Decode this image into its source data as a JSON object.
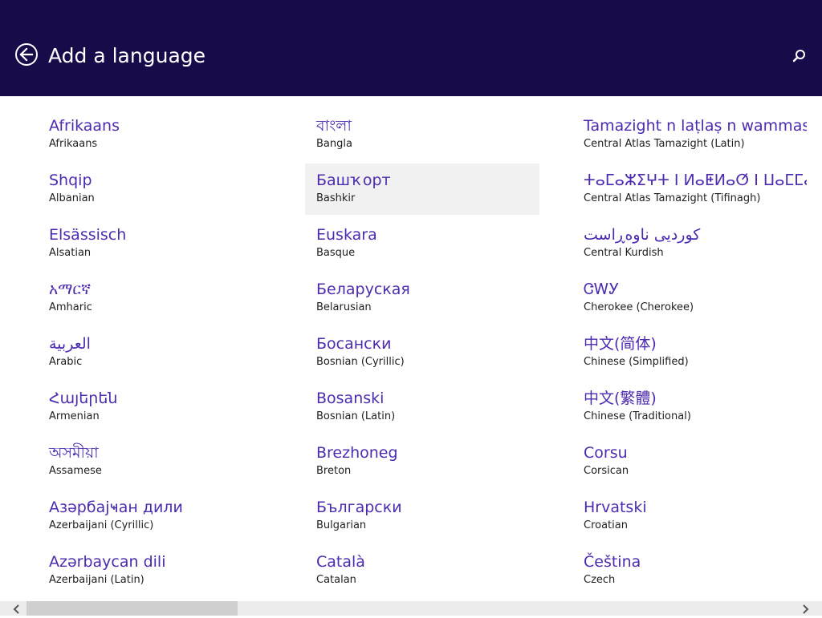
{
  "header": {
    "title": "Add a language",
    "back_icon": "back-arrow-circle-icon",
    "search_icon": "search-icon",
    "background": "#180b4a"
  },
  "columns": [
    [
      {
        "native": "Afrikaans",
        "english": "Afrikaans"
      },
      {
        "native": "Shqip",
        "english": "Albanian"
      },
      {
        "native": "Elsässisch",
        "english": "Alsatian"
      },
      {
        "native": "አማርኛ",
        "english": "Amharic"
      },
      {
        "native": "العربية",
        "english": "Arabic"
      },
      {
        "native": "Հայերեն",
        "english": "Armenian"
      },
      {
        "native": "অসমীয়া",
        "english": "Assamese"
      },
      {
        "native": "Азәрбајҹан дили",
        "english": "Azerbaijani (Cyrillic)"
      },
      {
        "native": "Azərbaycan dili",
        "english": "Azerbaijani (Latin)"
      }
    ],
    [
      {
        "native": "বাংলা",
        "english": "Bangla"
      },
      {
        "native": "Башҡорт",
        "english": "Bashkir",
        "hover": true
      },
      {
        "native": "Euskara",
        "english": "Basque"
      },
      {
        "native": "Беларуская",
        "english": "Belarusian"
      },
      {
        "native": "Босански",
        "english": "Bosnian (Cyrillic)"
      },
      {
        "native": "Bosanski",
        "english": "Bosnian (Latin)"
      },
      {
        "native": "Brezhoneg",
        "english": "Breton"
      },
      {
        "native": "Български",
        "english": "Bulgarian"
      },
      {
        "native": "Català",
        "english": "Catalan"
      }
    ],
    [
      {
        "native": "Tamazight n laṭlaṣ n wammas",
        "english": "Central Atlas Tamazight (Latin)"
      },
      {
        "native": "ⵜⴰⵎⴰⵣⵉⵖⵜ ⵏ ⵍⴰⵟⵍⴰⵚ ⵏ ⵡⴰⵎⵎⴰⵙ",
        "english": "Central Atlas Tamazight (Tifinagh)"
      },
      {
        "native": "کوردیی ناوەڕاست",
        "english": "Central Kurdish"
      },
      {
        "native": "ᏣᎳᎩ",
        "english": "Cherokee (Cherokee)"
      },
      {
        "native": "中文(简体)",
        "english": "Chinese (Simplified)"
      },
      {
        "native": "中文(繁體)",
        "english": "Chinese (Traditional)"
      },
      {
        "native": "Corsu",
        "english": "Corsican"
      },
      {
        "native": "Hrvatski",
        "english": "Croatian"
      },
      {
        "native": "Čeština",
        "english": "Czech"
      }
    ]
  ],
  "scrollbar": {
    "left_icon": "chevron-left-icon",
    "right_icon": "chevron-right-icon",
    "position": 0.0
  }
}
